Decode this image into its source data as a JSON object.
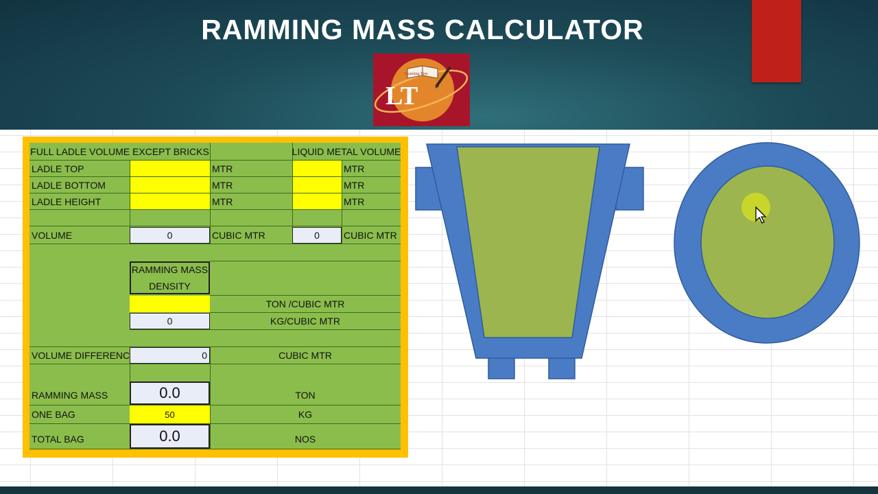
{
  "title": "RAMMING MASS CALCULATOR",
  "logo": {
    "text": "LT",
    "banner": "Learning Tree"
  },
  "panel": {
    "header_full": "FULL LADLE VOLUME EXCEPT BRICKS",
    "header_liquid": "LIQUID METAL VOLUME",
    "rows": {
      "ladle_top": "LADLE TOP",
      "ladle_bottom": "LADLE BOTTOM",
      "ladle_height": "LADLE HEIGHT",
      "volume": "VOLUME",
      "volume_difference": "VOLUME DIFFERENCE",
      "ramming_mass": "RAMMING MASS",
      "one_bag": "ONE BAG",
      "total_bag": "TOTAL BAG"
    },
    "units": {
      "mtr": "MTR",
      "cubic_mtr": "CUBIC MTR",
      "ton_cubic_mtr": "TON /CUBIC MTR",
      "kg_cubic_mtr": "KG/CUBIC MTR",
      "ton": "TON",
      "kg": "KG",
      "nos": "NOS"
    },
    "density_label_1": "RAMMING MASS",
    "density_label_2": "DENSITY",
    "values": {
      "volume_full": "0",
      "volume_liquid": "0",
      "density_kg": "0",
      "volume_difference": "0",
      "ramming_mass": "0.0",
      "one_bag": "50",
      "total_bag": "0.0"
    }
  },
  "colors": {
    "panel_border": "#ffc000",
    "panel_fill": "#8bbd4c",
    "input_yellow": "#ffff00",
    "shape_blue": "#4a7cc6",
    "shape_green": "#9cb54f",
    "header_red": "#c0201a"
  }
}
